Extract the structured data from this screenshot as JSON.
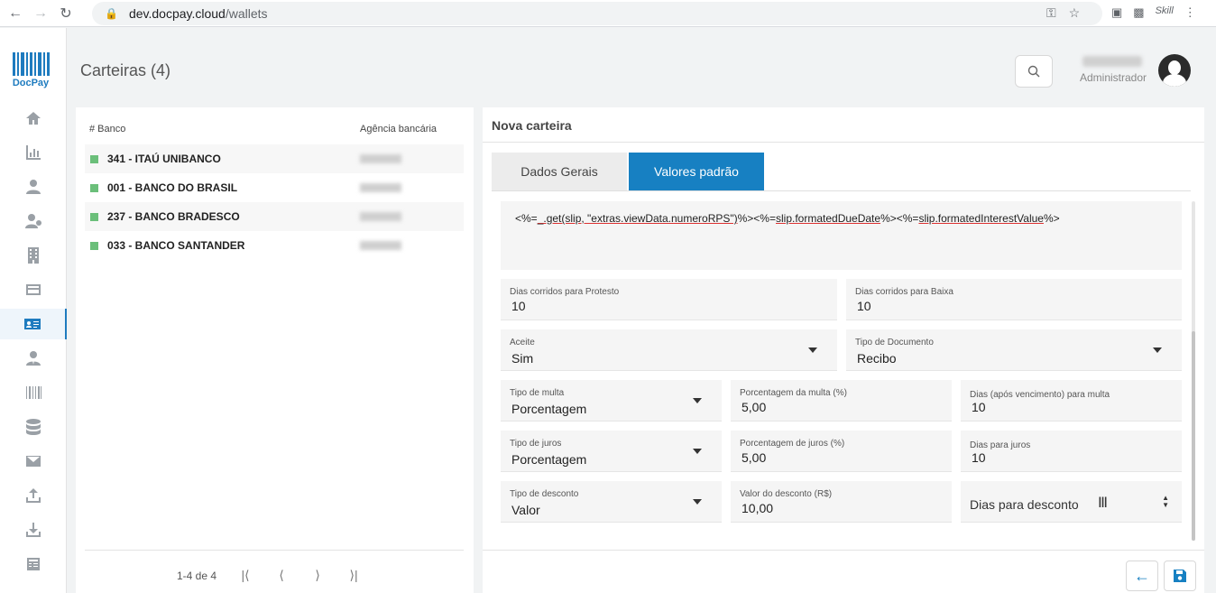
{
  "browser": {
    "url_domain": "dev.docpay.cloud",
    "url_path": "/wallets",
    "extension_label": "Skill"
  },
  "app": {
    "logo_text": "DocPay",
    "page_title": "Carteiras (4)",
    "user_role": "Administrador"
  },
  "sidebar": {
    "items": [
      {
        "icon": "home-icon"
      },
      {
        "icon": "chart-icon"
      },
      {
        "icon": "user-icon"
      },
      {
        "icon": "users-icon"
      },
      {
        "icon": "building-icon"
      },
      {
        "icon": "credit-card-icon"
      },
      {
        "icon": "wallet-card-icon",
        "active": true
      },
      {
        "icon": "manager-icon"
      },
      {
        "icon": "barcode-icon"
      },
      {
        "icon": "database-icon"
      },
      {
        "icon": "mail-icon"
      },
      {
        "icon": "upload-icon"
      },
      {
        "icon": "download-icon"
      },
      {
        "icon": "document-icon"
      }
    ]
  },
  "wallet_list": {
    "col_bank": "# Banco",
    "col_agency": "Agência bancária",
    "rows": [
      {
        "bank": "341 - ITAÚ UNIBANCO"
      },
      {
        "bank": "001 - BANCO DO BRASIL"
      },
      {
        "bank": "237 - BANCO BRADESCO"
      },
      {
        "bank": "033 - BANCO SANTANDER"
      }
    ],
    "pagination": "1-4 de 4",
    "status_color": "#6bbf7a"
  },
  "form": {
    "title": "Nova carteira",
    "tabs": {
      "general": "Dados Gerais",
      "defaults": "Valores padrão"
    },
    "template_parts": [
      "<%=",
      "_.get(slip, \"extras.viewData.numeroRPS\")",
      "%><%=",
      "slip.formatedDueDate",
      "%><%=",
      "slip.formatedInterestValue",
      "%>"
    ],
    "fields": {
      "protesto": {
        "label": "Dias corridos para Protesto",
        "value": "10"
      },
      "baixa": {
        "label": "Dias corridos para Baixa",
        "value": "10"
      },
      "aceite": {
        "label": "Aceite",
        "value": "Sim"
      },
      "tipo_documento": {
        "label": "Tipo de Documento",
        "value": "Recibo"
      },
      "tipo_multa": {
        "label": "Tipo de multa",
        "value": "Porcentagem"
      },
      "porcentagem_multa": {
        "label": "Porcentagem da multa (%)",
        "value": "5,00"
      },
      "dias_multa": {
        "label": "Dias (após vencimento) para multa",
        "value": "10"
      },
      "tipo_juros": {
        "label": "Tipo de juros",
        "value": "Porcentagem"
      },
      "porcentagem_juros": {
        "label": "Porcentagem de juros (%)",
        "value": "5,00"
      },
      "dias_juros": {
        "label": "Dias para juros",
        "value": "10"
      },
      "tipo_desconto": {
        "label": "Tipo de desconto",
        "value": "Valor"
      },
      "valor_desconto": {
        "label": "Valor do desconto (R$)",
        "value": "10,00"
      },
      "dias_desconto": {
        "placeholder": "Dias para desconto"
      }
    }
  },
  "colors": {
    "accent": "#1780c2",
    "brand": "#1e7bbf"
  }
}
